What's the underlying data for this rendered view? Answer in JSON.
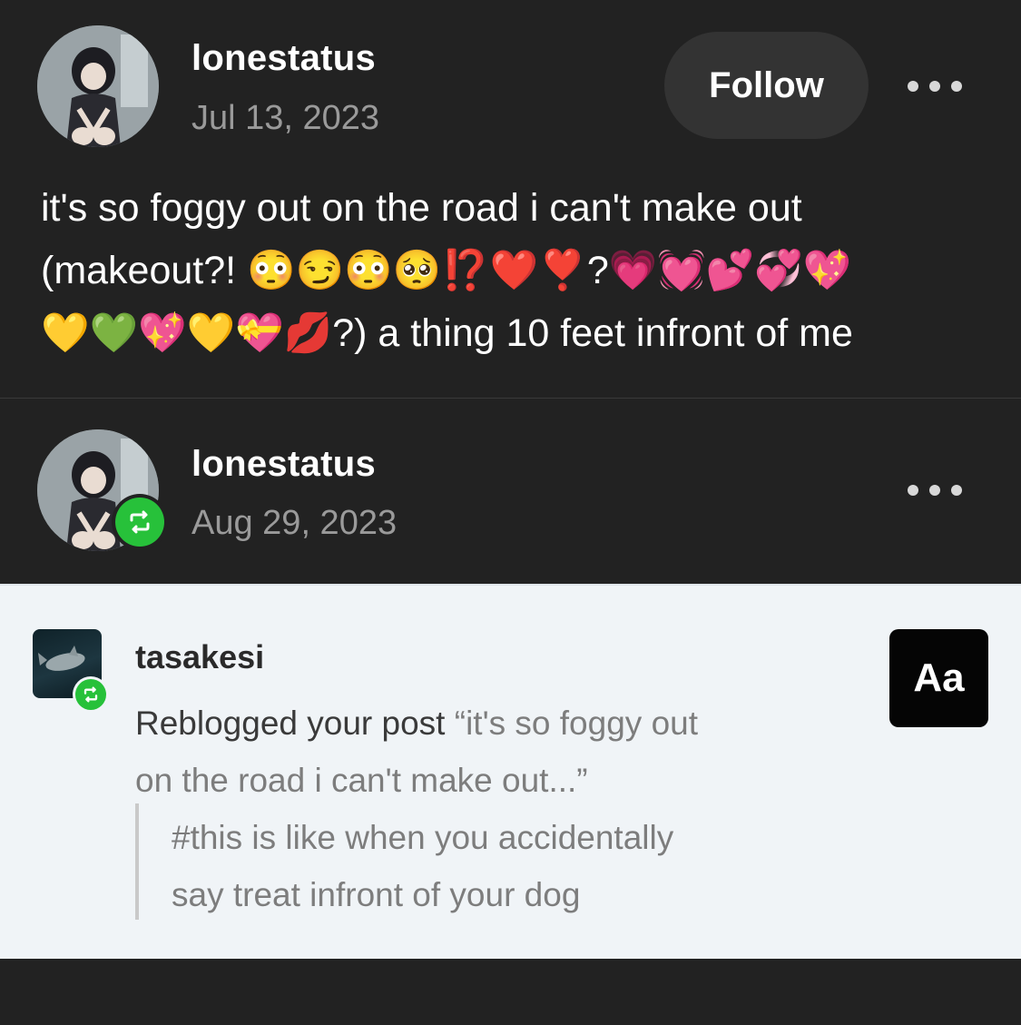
{
  "post": {
    "username": "lonestatus",
    "date": "Jul 13, 2023",
    "follow_label": "Follow",
    "body_line_1": "it's so foggy out on the road i can't make out",
    "body_line_2": "(makeout?! 😳😏😳🥺⁉️❤️❣️?💗💓💕💞💖",
    "body_line_3": "💛💚💖💛💝💋?) a thing 10 feet infront of me"
  },
  "reblog": {
    "username": "lonestatus",
    "date": "Aug 29, 2023"
  },
  "notification": {
    "username": "tasakesi",
    "action_text": "Reblogged your post",
    "quote_line_1": "“it's so foggy out",
    "quote_line_2": "on the road i can't make out...”",
    "tags_line_1": "#this is like when you accidentally",
    "tags_line_2": "say treat infront of your dog",
    "aa_label": "Aa"
  },
  "icons": {
    "more": "more-horizontal-icon",
    "reblog": "reblog-icon"
  },
  "colors": {
    "background": "#222222",
    "follow_button": "#333333",
    "reblog_green": "#27c13a",
    "notification_bg": "#f0f4f7"
  }
}
